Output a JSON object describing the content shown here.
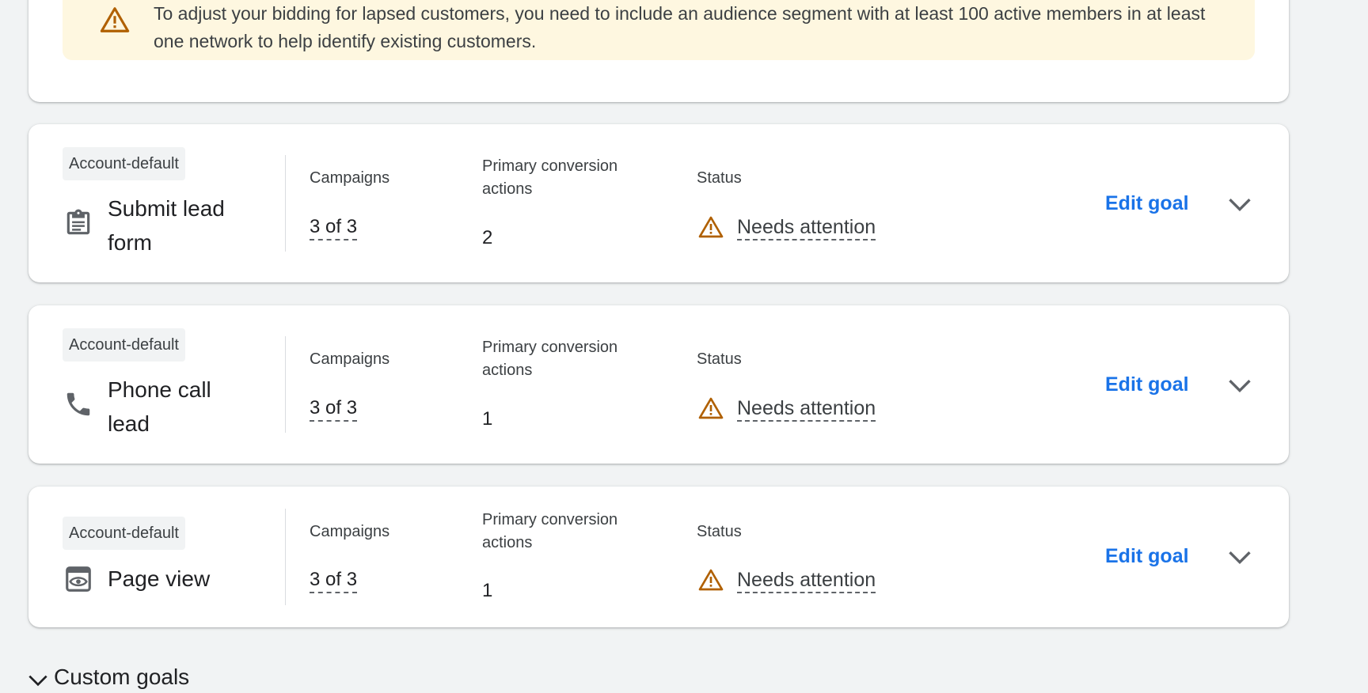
{
  "banner": {
    "message": "To adjust your bidding for lapsed customers, you need to include an audience segment with at least 100 active members in at least one network to help identify existing customers."
  },
  "columns": {
    "campaigns": "Campaigns",
    "primary_actions": "Primary conversion actions",
    "status": "Status"
  },
  "goals": [
    {
      "badge": "Account-default",
      "name": "Submit lead form",
      "icon": "clipboard-icon",
      "campaigns": "3 of 3",
      "primary_actions": "2",
      "status": "Needs attention",
      "edit_label": "Edit goal"
    },
    {
      "badge": "Account-default",
      "name": "Phone call lead",
      "icon": "phone-icon",
      "campaigns": "3 of 3",
      "primary_actions": "1",
      "status": "Needs attention",
      "edit_label": "Edit goal"
    },
    {
      "badge": "Account-default",
      "name": "Page view",
      "icon": "page-view-icon",
      "campaigns": "3 of 3",
      "primary_actions": "1",
      "status": "Needs attention",
      "edit_label": "Edit goal"
    }
  ],
  "custom_goals": {
    "label": "Custom goals"
  },
  "colors": {
    "warning": "#b06000",
    "link": "#1a73e8",
    "banner_bg": "#fef7e0",
    "page_bg": "#f1f3f4"
  }
}
